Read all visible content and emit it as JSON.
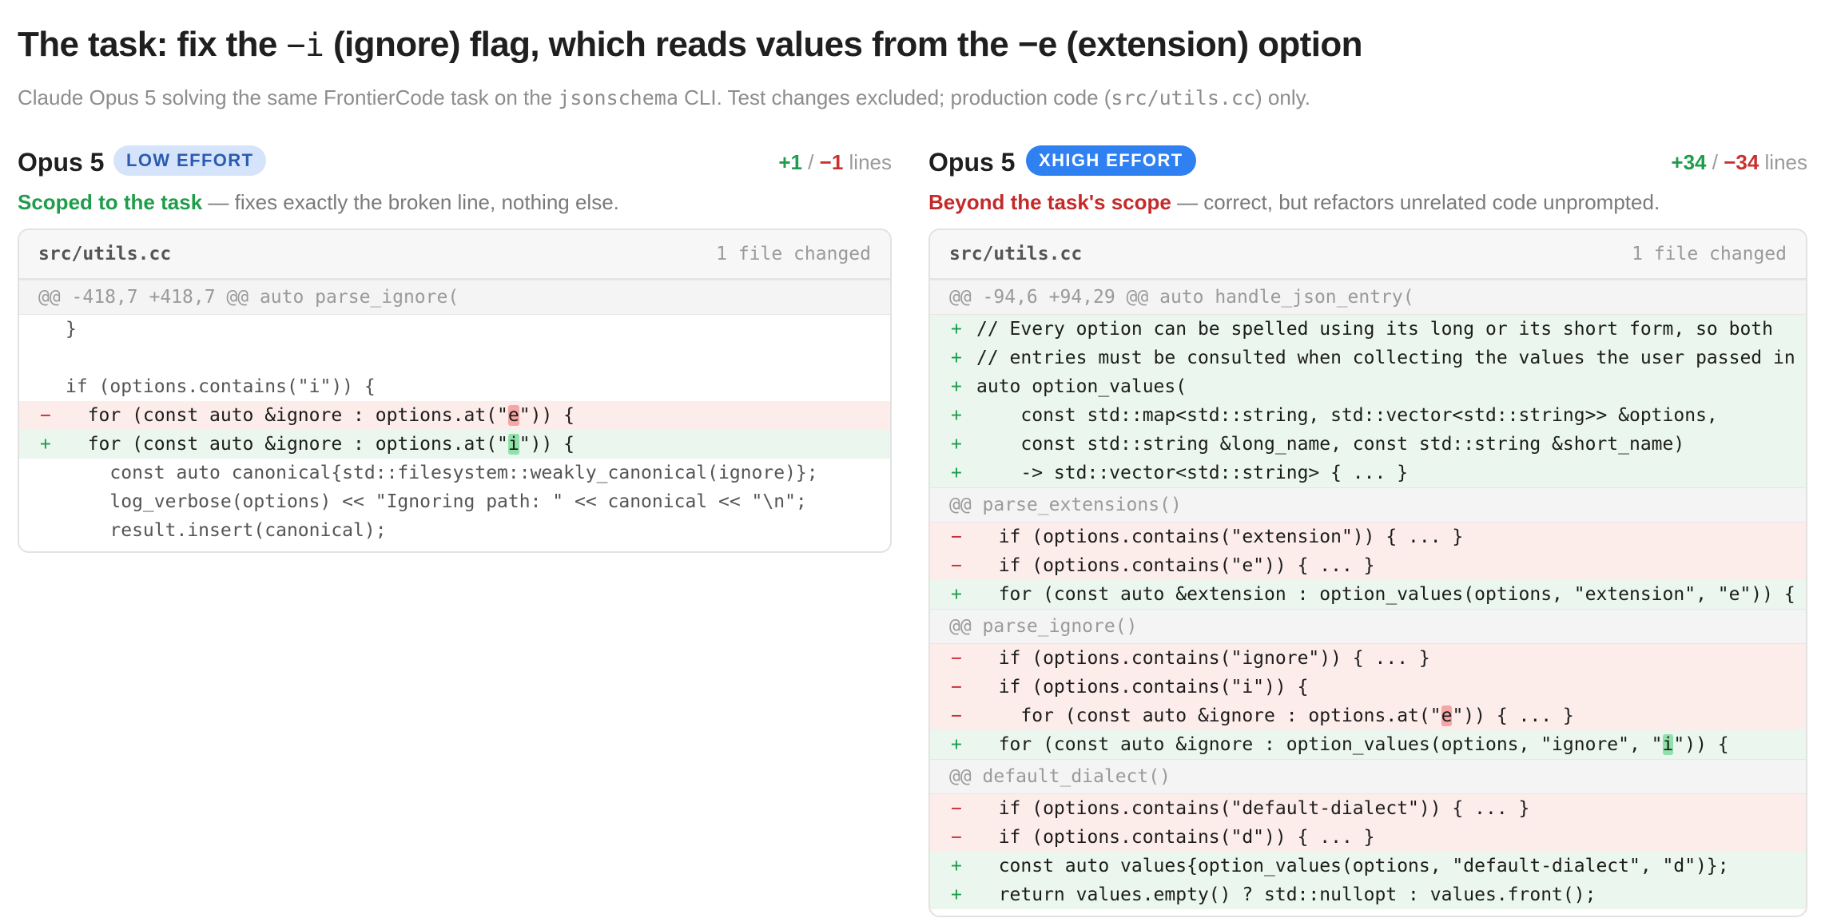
{
  "header": {
    "title_pre": "The task: fix the ",
    "title_flag_i": "−i",
    "title_mid": " (ignore) flag, which reads values from the ",
    "title_flag_e": "−e",
    "title_post": " (extension) option",
    "subtitle_pre": "Claude Opus 5 solving the same FrontierCode task on the ",
    "subtitle_tool": "jsonschema",
    "subtitle_mid": " CLI. Test changes excluded; production code (",
    "subtitle_file": "src/utils.cc",
    "subtitle_post": ") only."
  },
  "left": {
    "model": "Opus 5",
    "badge": "LOW EFFORT",
    "added": "+1",
    "sep": " / ",
    "removed": "−1",
    "lines_word": " lines",
    "verdict_strong": "Scoped to the task",
    "verdict_rest": " — fixes exactly the broken line, nothing else.",
    "file": "src/utils.cc",
    "file_changed": "1 file changed",
    "hunk": "@@ -418,7 +418,7 @@ auto parse_ignore(",
    "lines": [
      {
        "type": "ctx",
        "sign": "",
        "code": "}"
      },
      {
        "type": "ctx",
        "sign": "",
        "code": ""
      },
      {
        "type": "ctx",
        "sign": "",
        "code": "if (options.contains(\"i\")) {"
      },
      {
        "type": "del",
        "sign": "−",
        "pre": "  for (const auto &ignore : options.at(\"",
        "hl": "e",
        "post": "\")) {"
      },
      {
        "type": "add",
        "sign": "+",
        "pre": "  for (const auto &ignore : options.at(\"",
        "hl": "i",
        "post": "\")) {"
      },
      {
        "type": "ctx",
        "sign": "",
        "code": "    const auto canonical{std::filesystem::weakly_canonical(ignore)};"
      },
      {
        "type": "ctx",
        "sign": "",
        "code": "    log_verbose(options) << \"Ignoring path: \" << canonical << \"\\n\";"
      },
      {
        "type": "ctx",
        "sign": "",
        "code": "    result.insert(canonical);"
      }
    ]
  },
  "right": {
    "model": "Opus 5",
    "badge": "XHIGH EFFORT",
    "added": "+34",
    "sep": " / ",
    "removed": "−34",
    "lines_word": " lines",
    "verdict_strong": "Beyond the task's scope",
    "verdict_rest": " — correct, but refactors unrelated code unprompted.",
    "file": "src/utils.cc",
    "file_changed": "1 file changed",
    "hunk1": "@@ -94,6 +94,29 @@ auto handle_json_entry(",
    "hunk1_lines": [
      {
        "type": "add",
        "sign": "+",
        "code": "// Every option can be spelled using its long or its short form, so both"
      },
      {
        "type": "add",
        "sign": "+",
        "code": "// entries must be consulted when collecting the values the user passed in"
      },
      {
        "type": "add",
        "sign": "+",
        "code": "auto option_values("
      },
      {
        "type": "add",
        "sign": "+",
        "code": "    const std::map<std::string, std::vector<std::string>> &options,"
      },
      {
        "type": "add",
        "sign": "+",
        "code": "    const std::string &long_name, const std::string &short_name)"
      },
      {
        "type": "add",
        "sign": "+",
        "code": "    -> std::vector<std::string> { ... }"
      }
    ],
    "hunk2": "@@ parse_extensions()",
    "hunk2_lines": [
      {
        "type": "del",
        "sign": "−",
        "code": "  if (options.contains(\"extension\")) { ... }"
      },
      {
        "type": "del",
        "sign": "−",
        "code": "  if (options.contains(\"e\")) { ... }"
      },
      {
        "type": "add",
        "sign": "+",
        "code": "  for (const auto &extension : option_values(options, \"extension\", \"e\")) {"
      }
    ],
    "hunk3": "@@ parse_ignore()",
    "hunk3_lines": [
      {
        "type": "del",
        "sign": "−",
        "code": "  if (options.contains(\"ignore\")) { ... }"
      },
      {
        "type": "del",
        "sign": "−",
        "code": "  if (options.contains(\"i\")) {"
      },
      {
        "type": "del",
        "sign": "−",
        "pre": "    for (const auto &ignore : options.at(\"",
        "hl": "e",
        "post": "\")) { ... }"
      },
      {
        "type": "add",
        "sign": "+",
        "pre": "  for (const auto &ignore : option_values(options, \"ignore\", \"",
        "hl": "i",
        "post": "\")) {"
      }
    ],
    "hunk4": "@@ default_dialect()",
    "hunk4_lines": [
      {
        "type": "del",
        "sign": "−",
        "code": "  if (options.contains(\"default-dialect\")) { ... }"
      },
      {
        "type": "del",
        "sign": "−",
        "code": "  if (options.contains(\"d\")) { ... }"
      },
      {
        "type": "add",
        "sign": "+",
        "code": "  const auto values{option_values(options, \"default-dialect\", \"d\")};"
      },
      {
        "type": "add",
        "sign": "+",
        "code": "  return values.empty() ? std::nullopt : values.front();"
      }
    ]
  }
}
